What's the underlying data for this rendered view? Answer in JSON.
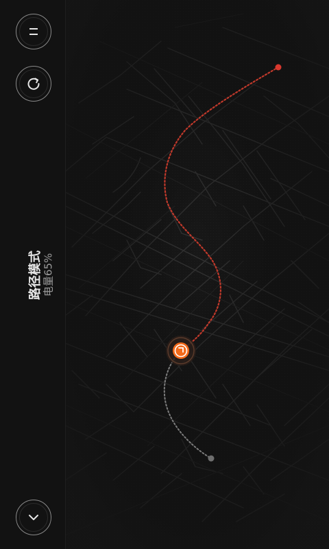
{
  "sidebar": {
    "mode_title": "路径模式",
    "battery_label": "电量65%"
  },
  "icons": {
    "menu": "menu-icon",
    "refresh": "refresh-icon",
    "down": "chevron-down-icon",
    "robot": "robot-marker-icon"
  },
  "colors": {
    "route_done": "#c0392b",
    "route_pending": "#8a8a8a",
    "marker": "#f26a1b",
    "background": "#171717"
  }
}
